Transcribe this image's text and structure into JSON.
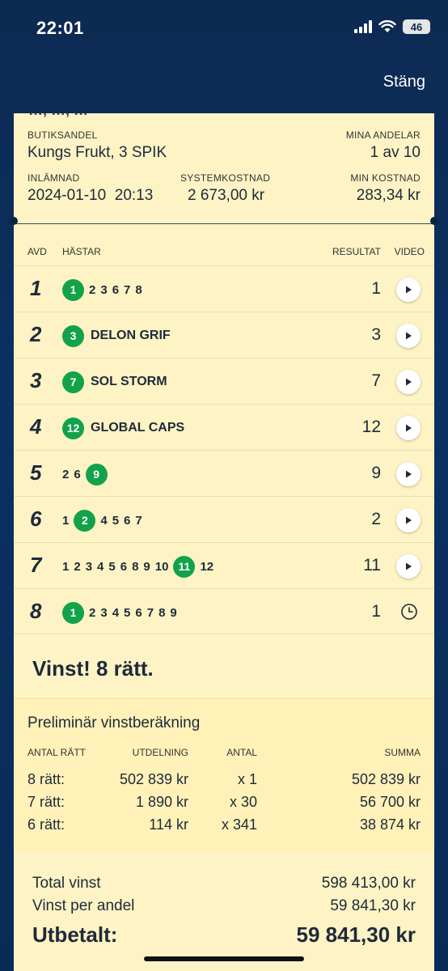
{
  "status_bar": {
    "time": "22:01",
    "battery": "46"
  },
  "nav": {
    "close_label": "Stäng"
  },
  "info": {
    "clipped_text": "…, …, …",
    "store_share_label": "BUTIKSANDEL",
    "store_share_value": "Kungs Frukt, 3 SPIK",
    "my_shares_label": "MINA ANDELAR",
    "my_shares_value": "1 av 10",
    "submitted_label": "INLÄMNAD",
    "submitted_value": "2024-01-10  20:13",
    "system_cost_label": "SYSTEMKOSTNAD",
    "system_cost_value": "2 673,00 kr",
    "my_cost_label": "MIN KOSTNAD",
    "my_cost_value": "283,34 kr"
  },
  "table": {
    "headers": {
      "race": "AVD",
      "horses": "HÄSTAR",
      "result": "RESULTAT",
      "video": "VIDEO"
    },
    "rows": [
      {
        "race": "1",
        "horses": [
          "1",
          "2",
          "3",
          "6",
          "7",
          "8"
        ],
        "winner": "1",
        "name": "",
        "result": "1",
        "video": "play"
      },
      {
        "race": "2",
        "horses": [
          "3"
        ],
        "winner": "3",
        "name": "DELON GRIF",
        "result": "3",
        "video": "play"
      },
      {
        "race": "3",
        "horses": [
          "7"
        ],
        "winner": "7",
        "name": "SOL STORM",
        "result": "7",
        "video": "play"
      },
      {
        "race": "4",
        "horses": [
          "12"
        ],
        "winner": "12",
        "name": "GLOBAL CAPS",
        "result": "12",
        "video": "play"
      },
      {
        "race": "5",
        "horses": [
          "2",
          "6",
          "9"
        ],
        "winner": "9",
        "name": "",
        "result": "9",
        "video": "play"
      },
      {
        "race": "6",
        "horses": [
          "1",
          "2",
          "4",
          "5",
          "6",
          "7"
        ],
        "winner": "2",
        "name": "",
        "result": "2",
        "video": "play"
      },
      {
        "race": "7",
        "horses": [
          "1",
          "2",
          "3",
          "4",
          "5",
          "6",
          "8",
          "9",
          "10",
          "11",
          "12"
        ],
        "winner": "11",
        "name": "",
        "result": "11",
        "video": "play"
      },
      {
        "race": "8",
        "horses": [
          "1",
          "2",
          "3",
          "4",
          "5",
          "6",
          "7",
          "8",
          "9"
        ],
        "winner": "1",
        "name": "",
        "result": "1",
        "video": "clock"
      }
    ]
  },
  "result_banner": "Vinst! 8 rätt.",
  "calc": {
    "title": "Preliminär vinstberäkning",
    "headers": {
      "correct": "ANTAL RÄTT",
      "payout": "UTDELNING",
      "count": "ANTAL",
      "sum": "SUMMA"
    },
    "rows": [
      {
        "correct": "8 rätt:",
        "payout": "502 839 kr",
        "count": "x 1",
        "sum": "502 839 kr"
      },
      {
        "correct": "7 rätt:",
        "payout": "1 890 kr",
        "count": "x 30",
        "sum": "56 700 kr"
      },
      {
        "correct": "6 rätt:",
        "payout": "114 kr",
        "count": "x 341",
        "sum": "38 874 kr"
      }
    ]
  },
  "totals": {
    "total_label": "Total vinst",
    "total_value": "598 413,00 kr",
    "per_share_label": "Vinst per andel",
    "per_share_value": "59 841,30 kr",
    "paid_label": "Utbetalt:",
    "paid_value": "59 841,30 kr"
  },
  "colors": {
    "background": "#0b3061",
    "card": "#fdf3c4",
    "winner_badge": "#12a24a",
    "text": "#1e2a3a"
  }
}
